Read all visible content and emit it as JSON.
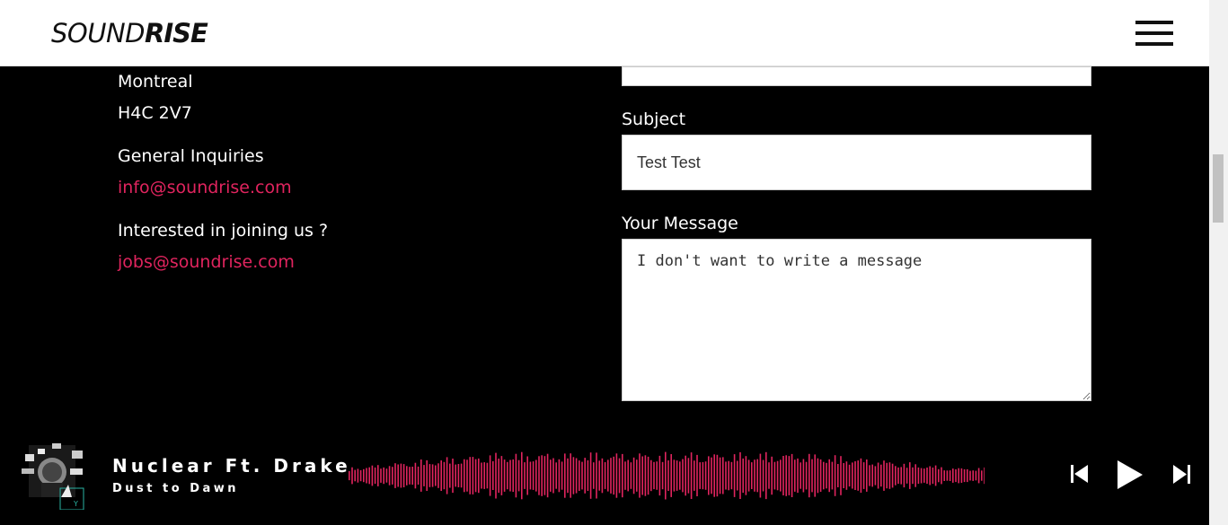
{
  "header": {
    "logo_light": "SOUND",
    "logo_bold": "RISE",
    "menu_icon": "hamburger-menu-icon"
  },
  "contact": {
    "city": "Montreal",
    "postal_code": "H4C 2V7",
    "general_label": "General Inquiries",
    "general_email": "info@soundrise.com",
    "jobs_label": "Interested in joining us ?",
    "jobs_email": "jobs@soundrise.com"
  },
  "form": {
    "subject_label": "Subject",
    "subject_value": "Test Test",
    "message_label": "Your Message",
    "message_value": "I don't want to write a message"
  },
  "player": {
    "cover_icon": "album-cover-image",
    "title": "Nuclear Ft. Drake",
    "album": "Dust to Dawn",
    "prev_icon": "skip-previous-icon",
    "play_icon": "play-icon",
    "next_icon": "skip-next-icon",
    "waveform_color": "#e0245e",
    "progress": 0
  },
  "colors": {
    "accent": "#e0245e",
    "background": "#000000",
    "header_bg": "#ffffff"
  }
}
